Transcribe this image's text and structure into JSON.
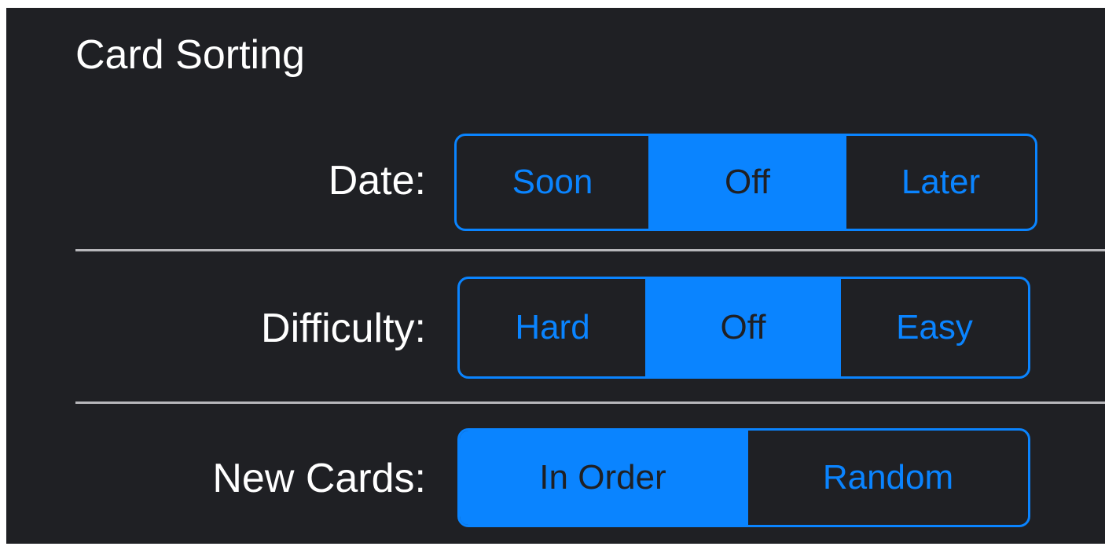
{
  "section": {
    "title": "Card Sorting"
  },
  "rows": [
    {
      "label": "Date:",
      "segments": [
        "Soon",
        "Off",
        "Later"
      ],
      "selected_index": 1
    },
    {
      "label": "Difficulty:",
      "segments": [
        "Hard",
        "Off",
        "Easy"
      ],
      "selected_index": 1
    },
    {
      "label": "New Cards:",
      "segments": [
        "In Order",
        "Random"
      ],
      "selected_index": 0
    }
  ],
  "colors": {
    "background": "#1f2024",
    "accent": "#0a84ff",
    "text": "#ffffff",
    "divider": "#b7b7bb"
  }
}
